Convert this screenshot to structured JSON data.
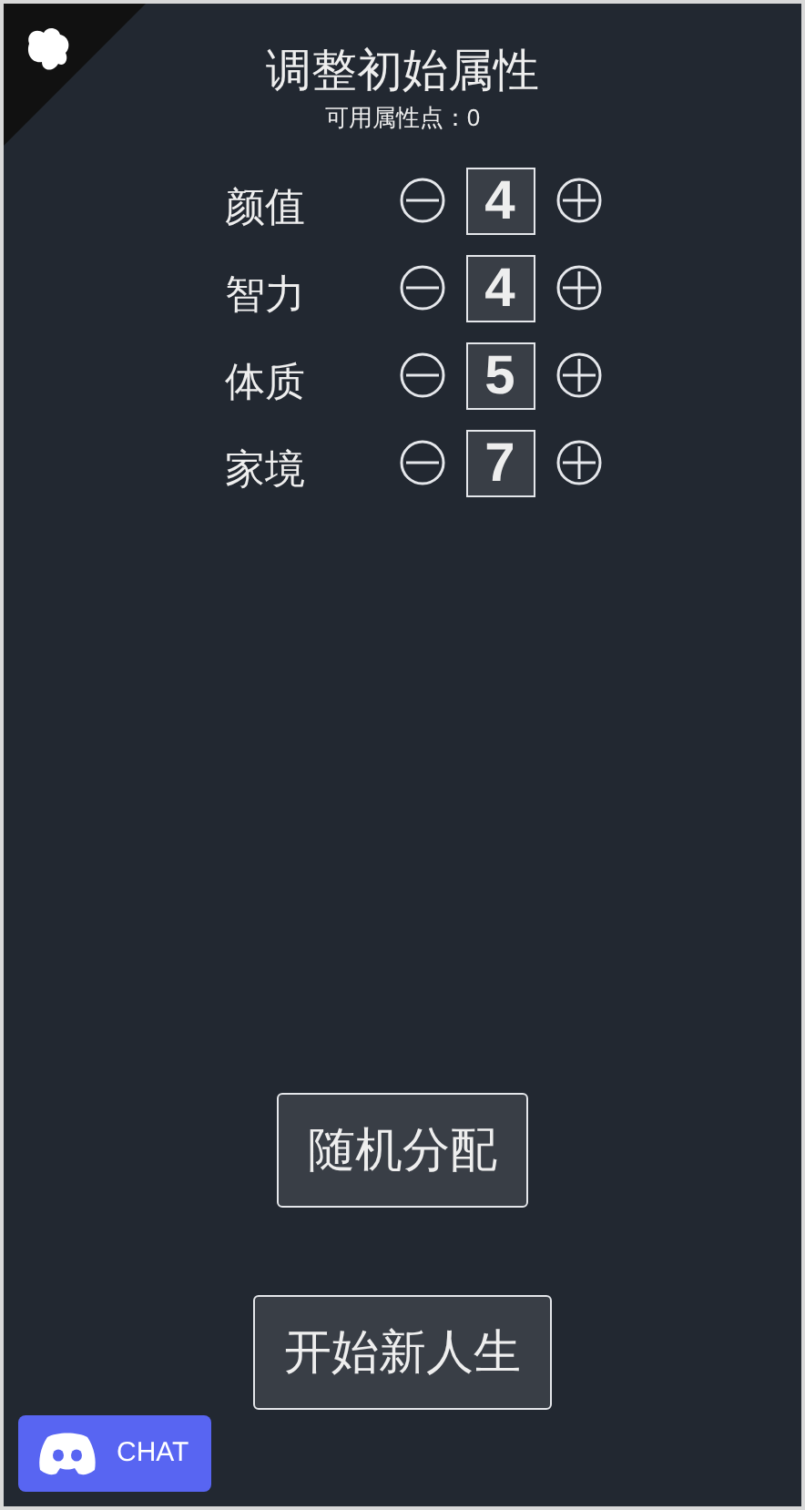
{
  "title": "调整初始属性",
  "points": "可用属性点：0",
  "attributes": [
    {
      "label": "颜值",
      "value": "4"
    },
    {
      "label": "智力",
      "value": "4"
    },
    {
      "label": "体质",
      "value": "5"
    },
    {
      "label": "家境",
      "value": "7"
    }
  ],
  "buttons": [
    "随机分配",
    "开始新人生"
  ],
  "chat": {
    "label": "CHAT"
  }
}
